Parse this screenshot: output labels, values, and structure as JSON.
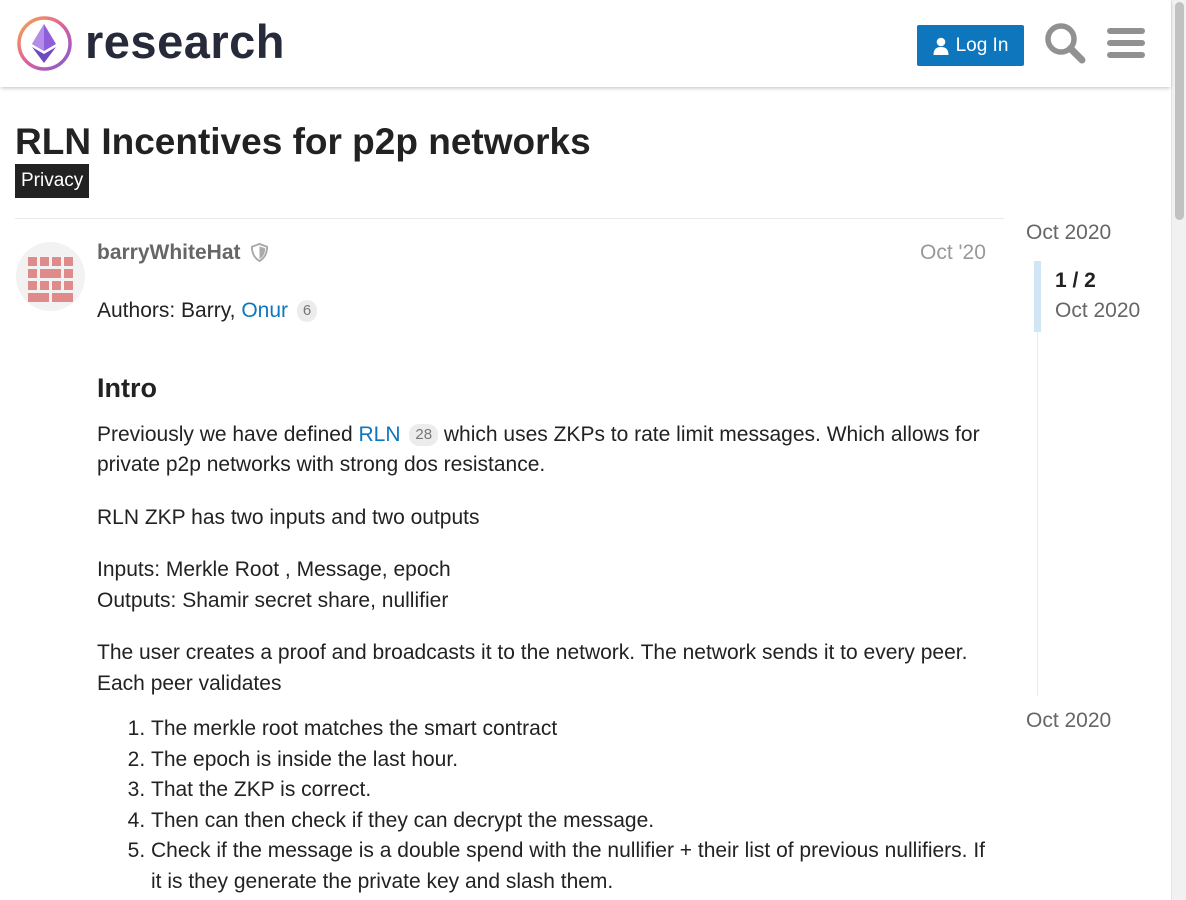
{
  "header": {
    "logo_text": "research",
    "login_label": "Log In",
    "brand_color": "#0e76bd"
  },
  "topic": {
    "title": "RLN Incentives for p2p networks",
    "category": "Privacy"
  },
  "post": {
    "username": "barryWhiteHat",
    "date": "Oct '20",
    "authors_prefix": "Authors: Barry,",
    "authors_link": "Onur",
    "authors_link_count": "6",
    "heading": "Intro",
    "intro_prefix": "Previously we have defined",
    "intro_link": "RLN",
    "intro_link_count": "28",
    "intro_suffix": "which uses ZKPs to rate limit messages. Which allows for private p2p networks with strong dos resistance.",
    "para2": "RLN ZKP has two inputs and two outputs",
    "inputs_line": "Inputs: Merkle Root , Message, epoch",
    "outputs_line": "Outputs: Shamir secret share, nullifier",
    "para4": "The user creates a proof and broadcasts it to the network. The network sends it to every peer. Each peer validates",
    "steps": [
      "The merkle root matches the smart contract",
      "The epoch is inside the last hour.",
      "That the ZKP is correct.",
      "Then can then check if they can decrypt the message.",
      "Check if the message is a double spend with the nullifier + their list of previous nullifiers. If it is they generate the private key and slash them."
    ]
  },
  "timeline": {
    "start_date": "Oct 2020",
    "position": "1 / 2",
    "current_date": "Oct 2020",
    "end_date": "Oct 2020"
  }
}
